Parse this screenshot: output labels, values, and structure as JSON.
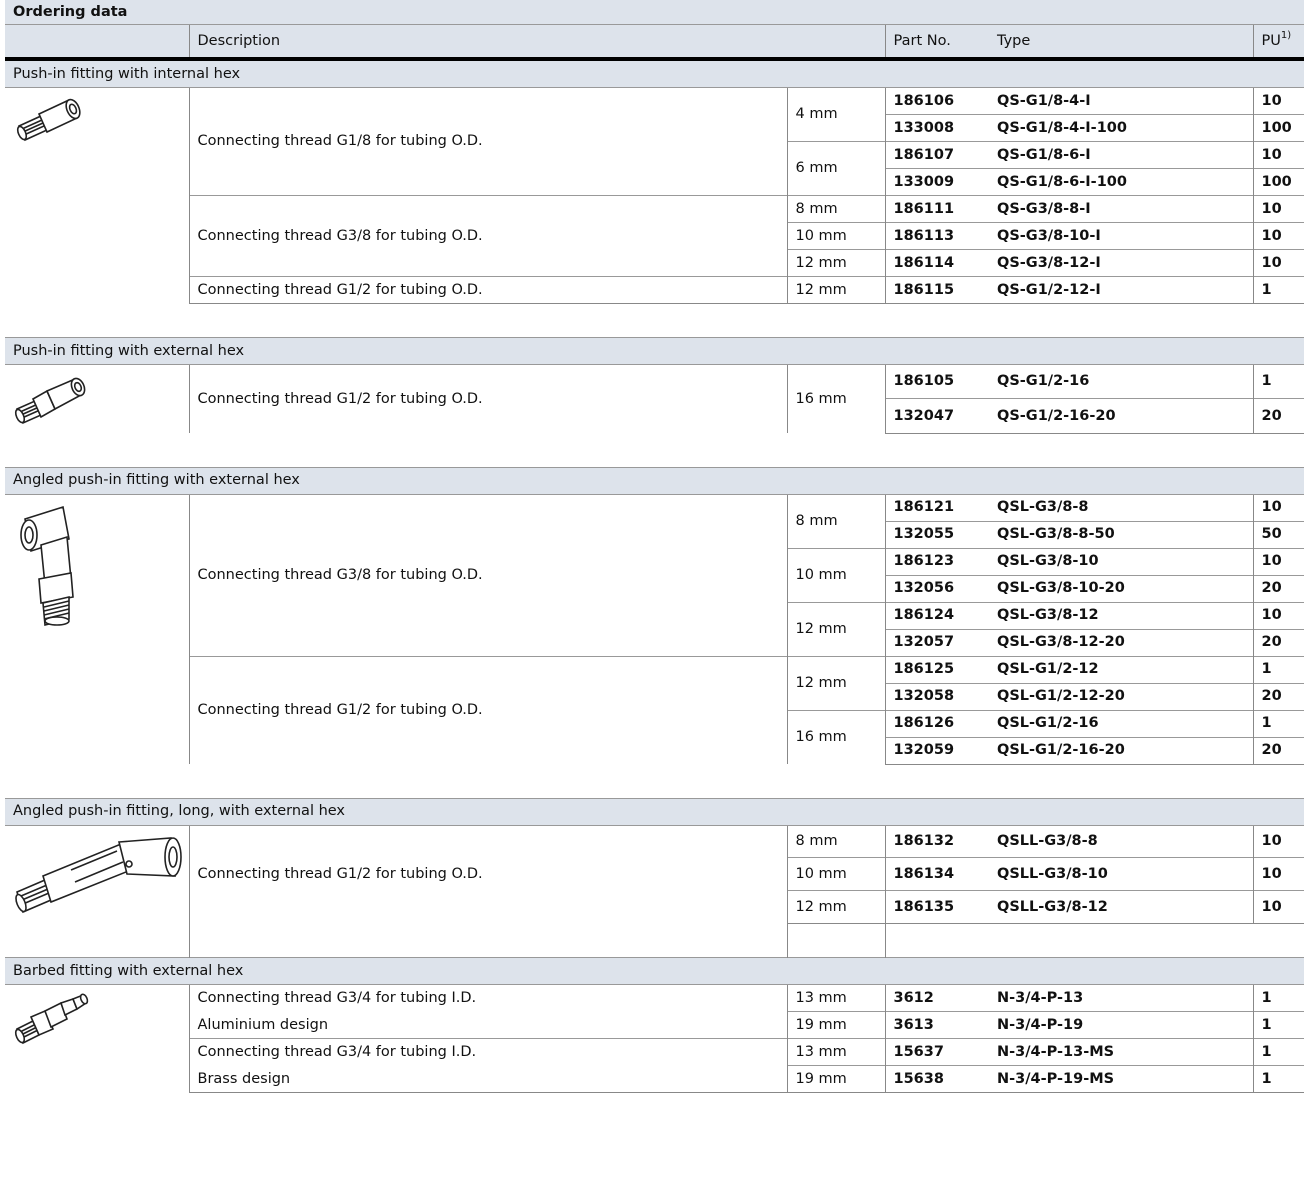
{
  "title": "Ordering data",
  "header": {
    "description": "Description",
    "part_no": "Part No.",
    "type": "Type",
    "pu": "PU",
    "pu_note": "1)"
  },
  "sections": [
    {
      "title": "Push-in fitting with internal hex",
      "image": "straight-fitting-internal-hex-icon",
      "groups": [
        {
          "description": "Connecting thread G1/8 for tubing O.D.",
          "sizes": [
            {
              "size": "4 mm",
              "items": [
                {
                  "part": "186106",
                  "type": "QS-G1/8-4-I",
                  "pu": "10"
                },
                {
                  "part": "133008",
                  "type": "QS-G1/8-4-I-100",
                  "pu": "100"
                }
              ]
            },
            {
              "size": "6 mm",
              "items": [
                {
                  "part": "186107",
                  "type": "QS-G1/8-6-I",
                  "pu": "10"
                },
                {
                  "part": "133009",
                  "type": "QS-G1/8-6-I-100",
                  "pu": "100"
                }
              ]
            }
          ]
        },
        {
          "description": "Connecting thread G3/8 for tubing O.D.",
          "sizes": [
            {
              "size": "8 mm",
              "items": [
                {
                  "part": "186111",
                  "type": "QS-G3/8-8-I",
                  "pu": "10"
                }
              ]
            },
            {
              "size": "10 mm",
              "items": [
                {
                  "part": "186113",
                  "type": "QS-G3/8-10-I",
                  "pu": "10"
                }
              ]
            },
            {
              "size": "12 mm",
              "items": [
                {
                  "part": "186114",
                  "type": "QS-G3/8-12-I",
                  "pu": "10"
                }
              ]
            }
          ]
        },
        {
          "description": "Connecting thread G1/2 for tubing O.D.",
          "sizes": [
            {
              "size": "12 mm",
              "items": [
                {
                  "part": "186115",
                  "type": "QS-G1/2-12-I",
                  "pu": "1"
                }
              ]
            }
          ]
        }
      ]
    },
    {
      "title": "Push-in fitting with external hex",
      "image": "straight-fitting-external-hex-icon",
      "groups": [
        {
          "description": "Connecting thread G1/2 for tubing O.D.",
          "sizes": [
            {
              "size": "16 mm",
              "items": [
                {
                  "part": "186105",
                  "type": "QS-G1/2-16",
                  "pu": "1"
                },
                {
                  "part": "132047",
                  "type": "QS-G1/2-16-20",
                  "pu": "20"
                }
              ]
            }
          ]
        }
      ]
    },
    {
      "title": "Angled push-in fitting with external hex",
      "image": "elbow-fitting-icon",
      "groups": [
        {
          "description": "Connecting thread G3/8 for tubing O.D.",
          "sizes": [
            {
              "size": "8 mm",
              "items": [
                {
                  "part": "186121",
                  "type": "QSL-G3/8-8",
                  "pu": "10"
                },
                {
                  "part": "132055",
                  "type": "QSL-G3/8-8-50",
                  "pu": "50"
                }
              ]
            },
            {
              "size": "10 mm",
              "items": [
                {
                  "part": "186123",
                  "type": "QSL-G3/8-10",
                  "pu": "10"
                },
                {
                  "part": "132056",
                  "type": "QSL-G3/8-10-20",
                  "pu": "20"
                }
              ]
            },
            {
              "size": "12 mm",
              "items": [
                {
                  "part": "186124",
                  "type": "QSL-G3/8-12",
                  "pu": "10"
                },
                {
                  "part": "132057",
                  "type": "QSL-G3/8-12-20",
                  "pu": "20"
                }
              ]
            }
          ]
        },
        {
          "description": "Connecting thread G1/2 for tubing O.D.",
          "sizes": [
            {
              "size": "12 mm",
              "items": [
                {
                  "part": "186125",
                  "type": "QSL-G1/2-12",
                  "pu": "1"
                },
                {
                  "part": "132058",
                  "type": "QSL-G1/2-12-20",
                  "pu": "20"
                }
              ]
            },
            {
              "size": "16 mm",
              "items": [
                {
                  "part": "186126",
                  "type": "QSL-G1/2-16",
                  "pu": "1"
                },
                {
                  "part": "132059",
                  "type": "QSL-G1/2-16-20",
                  "pu": "20"
                }
              ]
            }
          ]
        }
      ]
    },
    {
      "title": "Angled push-in fitting, long, with external hex",
      "image": "long-elbow-fitting-icon",
      "groups": [
        {
          "description": "Connecting thread G1/2 for tubing O.D.",
          "sizes": [
            {
              "size": "8 mm",
              "items": [
                {
                  "part": "186132",
                  "type": "QSLL-G3/8-8",
                  "pu": "10"
                }
              ]
            },
            {
              "size": "10 mm",
              "items": [
                {
                  "part": "186134",
                  "type": "QSLL-G3/8-10",
                  "pu": "10"
                }
              ]
            },
            {
              "size": "12 mm",
              "items": [
                {
                  "part": "186135",
                  "type": "QSLL-G3/8-12",
                  "pu": "10"
                }
              ]
            }
          ]
        }
      ]
    },
    {
      "title": "Barbed fitting with external hex",
      "image": "barbed-fitting-icon",
      "rows": [
        {
          "desc": "Connecting thread G3/4 for tubing I.D.",
          "size": "13 mm",
          "part": "3612",
          "type": "N-3/4-P-13",
          "pu": "1"
        },
        {
          "desc": "Aluminium design",
          "size": "19 mm",
          "part": "3613",
          "type": "N-3/4-P-19",
          "pu": "1"
        },
        {
          "desc": "Connecting thread G3/4 for tubing I.D.",
          "size": "13 mm",
          "part": "15637",
          "type": "N-3/4-P-13-MS",
          "pu": "1"
        },
        {
          "desc": "Brass design",
          "size": "19 mm",
          "part": "15638",
          "type": "N-3/4-P-19-MS",
          "pu": "1"
        }
      ]
    }
  ]
}
